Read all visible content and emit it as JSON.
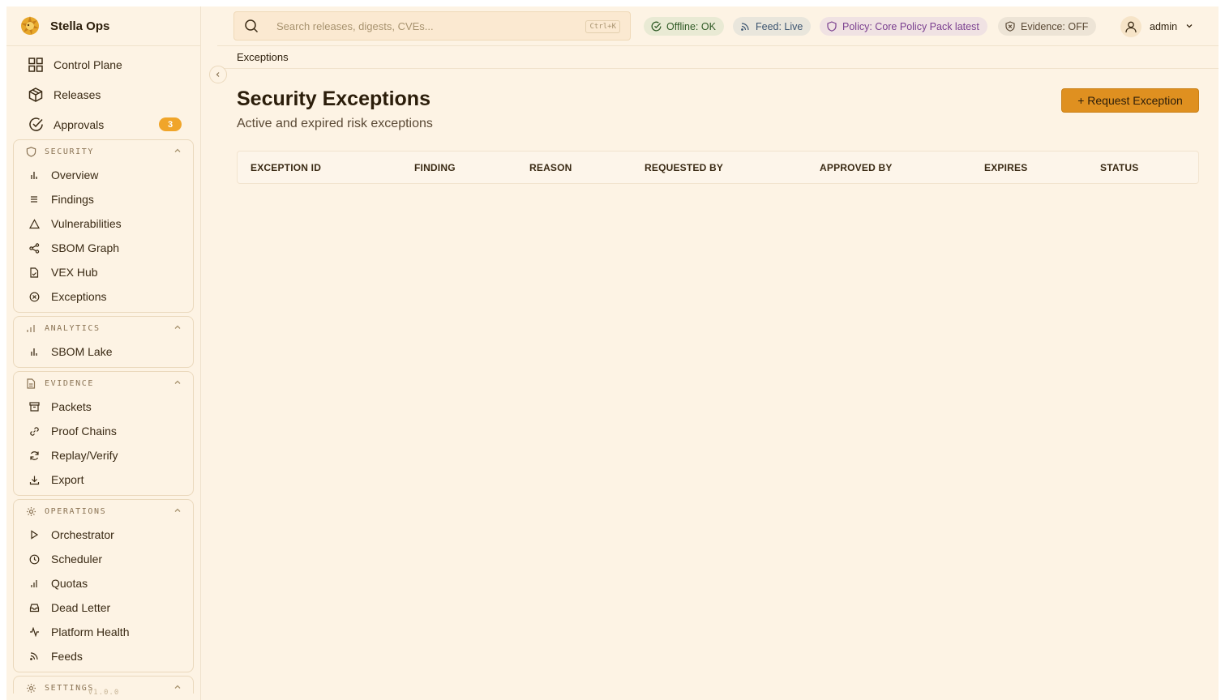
{
  "app": {
    "brand_name": "Stella Ops",
    "version": "V1.0.0"
  },
  "sidebar": {
    "top_items": [
      {
        "label": "Control Plane",
        "icon": "grid-icon"
      },
      {
        "label": "Releases",
        "icon": "package-icon"
      },
      {
        "label": "Approvals",
        "icon": "check-circle-icon",
        "badge": "3"
      }
    ],
    "groups": [
      {
        "title": "SECURITY",
        "icon": "shield-icon",
        "items": [
          {
            "label": "Overview",
            "icon": "bar-chart-icon"
          },
          {
            "label": "Findings",
            "icon": "list-icon"
          },
          {
            "label": "Vulnerabilities",
            "icon": "warning-triangle-icon"
          },
          {
            "label": "SBOM Graph",
            "icon": "share-graph-icon"
          },
          {
            "label": "VEX Hub",
            "icon": "file-check-icon"
          },
          {
            "label": "Exceptions",
            "icon": "x-circle-icon"
          }
        ]
      },
      {
        "title": "ANALYTICS",
        "icon": "analytics-icon",
        "items": [
          {
            "label": "SBOM Lake",
            "icon": "bar-chart-icon"
          }
        ]
      },
      {
        "title": "EVIDENCE",
        "icon": "document-icon",
        "items": [
          {
            "label": "Packets",
            "icon": "archive-icon"
          },
          {
            "label": "Proof Chains",
            "icon": "link-icon"
          },
          {
            "label": "Replay/Verify",
            "icon": "refresh-icon"
          },
          {
            "label": "Export",
            "icon": "download-icon"
          }
        ]
      },
      {
        "title": "OPERATIONS",
        "icon": "gear-icon",
        "items": [
          {
            "label": "Orchestrator",
            "icon": "play-icon"
          },
          {
            "label": "Scheduler",
            "icon": "clock-icon"
          },
          {
            "label": "Quotas",
            "icon": "bar-chart-icon"
          },
          {
            "label": "Dead Letter",
            "icon": "inbox-icon"
          },
          {
            "label": "Platform Health",
            "icon": "activity-icon"
          },
          {
            "label": "Feeds",
            "icon": "rss-icon"
          }
        ]
      },
      {
        "title": "SETTINGS",
        "icon": "gear-icon",
        "items": []
      }
    ]
  },
  "topbar": {
    "search_placeholder": "Search releases, digests, CVEs...",
    "search_shortcut": "Ctrl+K",
    "status": {
      "offline": "Offline: OK",
      "feed": "Feed: Live",
      "policy": "Policy: Core Policy Pack latest",
      "evidence": "Evidence: OFF"
    },
    "user_name": "admin"
  },
  "breadcrumb": "Exceptions",
  "page": {
    "title": "Security Exceptions",
    "subtitle": "Active and expired risk exceptions",
    "request_button": "+ Request Exception"
  },
  "table": {
    "columns": [
      "EXCEPTION ID",
      "FINDING",
      "REASON",
      "REQUESTED BY",
      "APPROVED BY",
      "EXPIRES",
      "STATUS"
    ],
    "rows": []
  },
  "colors": {
    "background": "#fdf3e4",
    "accent": "#df9020",
    "badge": "#f0a52a",
    "status_ok": "#2f5a25",
    "status_policy": "#7a3f8f"
  }
}
